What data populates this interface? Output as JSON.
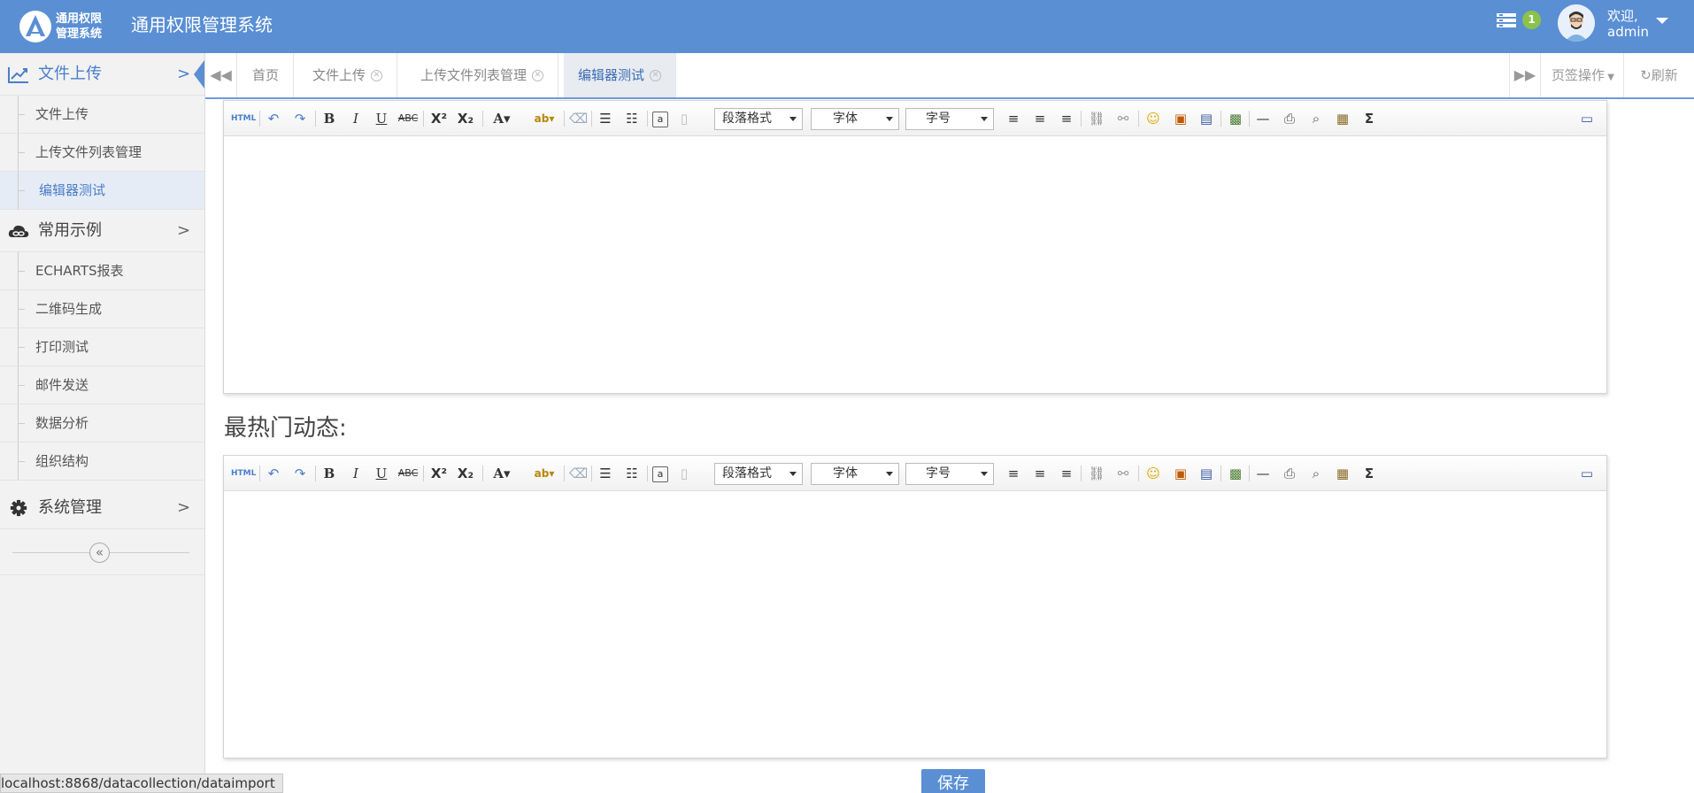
{
  "header": {
    "logo_line1": "通用权限",
    "logo_line2": "管理系统",
    "app_title": "通用权限管理系统",
    "notification_count": "1",
    "welcome_line1": "欢迎,",
    "welcome_line2": "admin",
    "accent_color": "#5a8fd4"
  },
  "sidebar": {
    "groups": [
      {
        "label": "文件上传",
        "icon": "line-chart-icon",
        "active": true,
        "items": [
          {
            "label": "文件上传"
          },
          {
            "label": "上传文件列表管理"
          },
          {
            "label": "编辑器测试",
            "active": true
          }
        ]
      },
      {
        "label": "常用示例",
        "icon": "cloud-link-icon",
        "items": [
          {
            "label": "ECHARTS报表"
          },
          {
            "label": "二维码生成"
          },
          {
            "label": "打印测试"
          },
          {
            "label": "邮件发送"
          },
          {
            "label": "数据分析"
          },
          {
            "label": "组织结构"
          }
        ]
      },
      {
        "label": "系统管理",
        "icon": "gear-icon",
        "items": []
      }
    ],
    "collapse_glyph": "«"
  },
  "tabs": {
    "items": [
      {
        "label": "首页"
      },
      {
        "label": "文件上传"
      },
      {
        "label": "上传文件列表管理"
      },
      {
        "label": "编辑器测试",
        "active": true
      }
    ],
    "ops_label": "页签操作",
    "refresh_label": "刷新"
  },
  "editor": {
    "combo_paragraph": "段落格式",
    "combo_font": "字体",
    "combo_size": "字号",
    "html_label": "HTML"
  },
  "content": {
    "section_title": "最热门动态:",
    "save_label": "保存"
  },
  "status_bar": {
    "url": "localhost:8868/datacollection/dataimport"
  }
}
